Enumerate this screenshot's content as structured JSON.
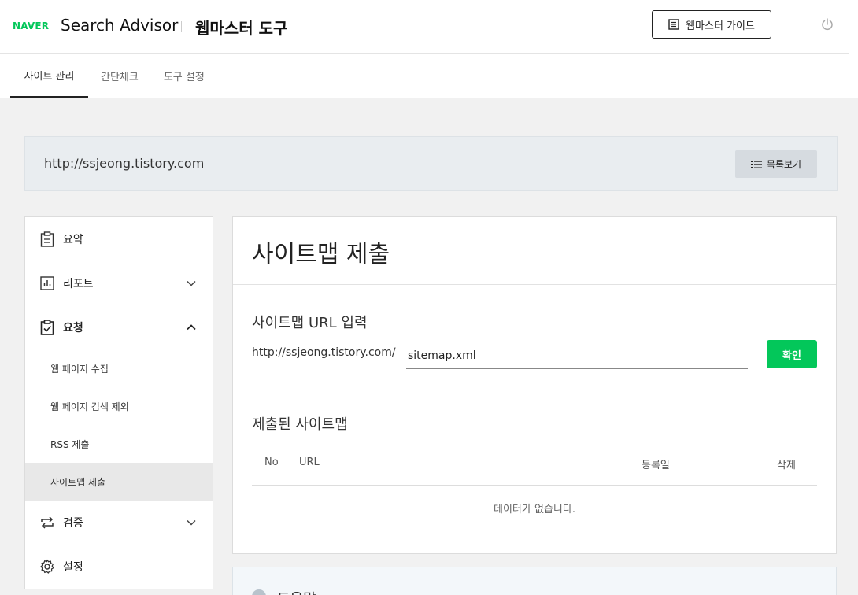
{
  "header": {
    "logo": "NAVER",
    "brand": "Search Advisor",
    "subtitle": "웹마스터 도구",
    "guide_label": "웹마스터 가이드"
  },
  "tabs": [
    {
      "label": "사이트 관리",
      "active": true
    },
    {
      "label": "간단체크",
      "active": false
    },
    {
      "label": "도구 설정",
      "active": false
    }
  ],
  "site": {
    "url": "http://ssjeong.tistory.com",
    "list_label": "목록보기"
  },
  "sidebar": {
    "items": [
      {
        "label": "요약",
        "icon": "clipboard-icon"
      },
      {
        "label": "리포트",
        "icon": "chart-icon",
        "expanded": false
      },
      {
        "label": "요청",
        "icon": "clipboard-check-icon",
        "expanded": true
      },
      {
        "label": "검증",
        "icon": "repeat-icon",
        "expanded": false
      },
      {
        "label": "설정",
        "icon": "gear-icon"
      }
    ],
    "subitems": [
      {
        "label": "웹 페이지 수집"
      },
      {
        "label": "웹 페이지 검색 제외"
      },
      {
        "label": "RSS 제출"
      },
      {
        "label": "사이트맵 제출",
        "active": true
      }
    ]
  },
  "main": {
    "title": "사이트맵 제출",
    "url_section_title": "사이트맵 URL 입력",
    "url_prefix": "http://ssjeong.tistory.com/",
    "url_value": "sitemap.xml",
    "confirm_label": "확인",
    "submitted_title": "제출된 사이트맵",
    "table": {
      "headers": [
        "No",
        "URL",
        "등록일",
        "삭제"
      ],
      "rows": [],
      "empty_message": "데이터가 없습니다."
    }
  },
  "help": {
    "title": "도움말"
  },
  "colors": {
    "accent": "#03c75a",
    "sitebar_bg": "#e9edf0",
    "active_sub_bg": "#e8e8e8"
  }
}
